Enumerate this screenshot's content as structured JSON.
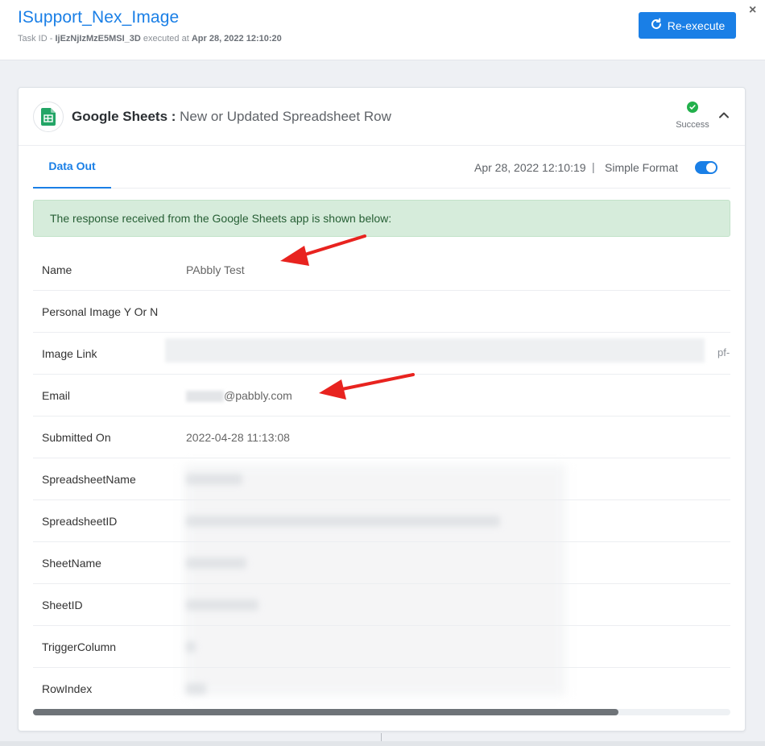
{
  "header": {
    "title": "ISupport_Nex_Image",
    "task_id_label": "Task ID -",
    "task_id": "IjEzNjIzMzE5MSI_3D",
    "executed_at_label": "executed at",
    "executed_at": "Apr 28, 2022 12:10:20",
    "reexecute_label": "Re-execute",
    "close_symbol": "×"
  },
  "step": {
    "app_name": "Google Sheets",
    "separator": " : ",
    "event_name": "New or Updated Spreadsheet Row",
    "status": "Success",
    "tab_label": "Data Out",
    "exec_time": "Apr 28, 2022 12:10:19",
    "pipe": "|",
    "simple_format_label": "Simple Format",
    "simple_format_on": true,
    "alert_text": "The response received from the Google Sheets app is shown below:"
  },
  "fields": [
    {
      "label": "Name",
      "value": "PAbbly Test"
    },
    {
      "label": "Personal Image Y Or N",
      "value": ""
    },
    {
      "label": "Image Link",
      "value": ""
    },
    {
      "label": "Email",
      "value": "@pabbly.com"
    },
    {
      "label": "Submitted On",
      "value": "2022-04-28 11:13:08"
    },
    {
      "label": "SpreadsheetName",
      "value": ""
    },
    {
      "label": "SpreadsheetID",
      "value": ""
    },
    {
      "label": "SheetName",
      "value": ""
    },
    {
      "label": "SheetID",
      "value": ""
    },
    {
      "label": "TriggerColumn",
      "value": ""
    },
    {
      "label": "RowIndex",
      "value": ""
    }
  ],
  "image_link_trailing": "pf-",
  "colors": {
    "accent": "#1a7fe6",
    "success": "#22b04b",
    "alert_bg": "#d6ecdb",
    "arrow": "#e8231f"
  },
  "icons": [
    "refresh-icon",
    "close-icon",
    "google-sheets-icon",
    "check-icon",
    "chevron-up-icon"
  ],
  "scroll": {
    "horizontal_position_fraction": 0.84
  }
}
